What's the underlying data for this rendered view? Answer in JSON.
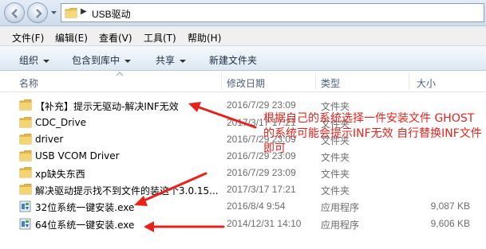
{
  "address": {
    "path": "USB驱动"
  },
  "menu": [
    "文件(F)",
    "编辑(E)",
    "查看(V)",
    "工具(T)",
    "帮助(H)"
  ],
  "toolbar": {
    "organize": "组织",
    "include_library": "包含到库中",
    "share": "共享",
    "new_folder": "新建文件夹"
  },
  "columns": {
    "name": "名称",
    "date": "修改日期",
    "type": "类型",
    "size": "大小"
  },
  "files": [
    {
      "name": "【补充】提示无驱动-解决INF无效",
      "date": "2016/7/29 23:09",
      "type": "文件夹",
      "size": "",
      "icon": "folder-icon"
    },
    {
      "name": "CDC_Drive",
      "date": "2017/3/17 17:21",
      "type": "文件夹",
      "size": "",
      "icon": "folder-icon"
    },
    {
      "name": "driver",
      "date": "2016/7/29 23:09",
      "type": "文件夹",
      "size": "",
      "icon": "folder-icon"
    },
    {
      "name": "USB VCOM Driver",
      "date": "2016/7/29 23:09",
      "type": "文件夹",
      "size": "",
      "icon": "folder-icon"
    },
    {
      "name": "xp缺失东西",
      "date": "2016/7/29 23:09",
      "type": "文件夹",
      "size": "",
      "icon": "folder-icon"
    },
    {
      "name": "解决驱动提示找不到文件的装这个3.0.15...",
      "date": "2017/3/17 17:21",
      "type": "文件夹",
      "size": "",
      "icon": "folder-icon"
    },
    {
      "name": "32位系统一键安装.exe",
      "date": "2016/8/4 9:54",
      "type": "应用程序",
      "size": "9,087 KB",
      "icon": "installer-icon"
    },
    {
      "name": "64位系统一键安装.exe",
      "date": "2014/12/31 14:10",
      "type": "应用程序",
      "size": "9,606 KB",
      "icon": "installer-icon"
    }
  ],
  "annotation": {
    "text": "根据自己的系统选择一件安装文件 GHOST的系统可能会提示INF无效 自行替换INF文件即可",
    "color": "#e8221b"
  }
}
